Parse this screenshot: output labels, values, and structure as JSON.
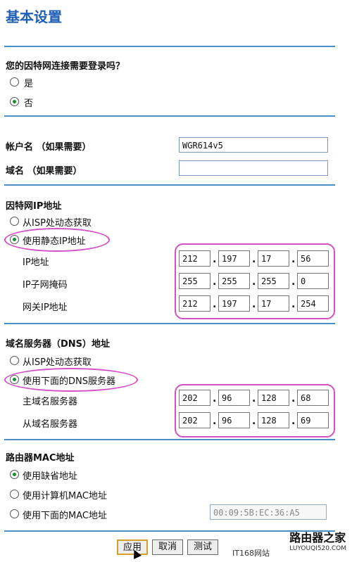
{
  "page": {
    "title": "基本设置",
    "q_login": "您的因特网连接需要登录吗？",
    "opt_yes": "是",
    "opt_no": "否",
    "account": {
      "label": "帐户名 （如果需要）",
      "value": "WGR614v5"
    },
    "domain": {
      "label": "域名 （如果需要）",
      "value": ""
    },
    "internet_ip": {
      "title": "因特网IP地址",
      "opt_dynamic": "从ISP处动态获取",
      "opt_static": "使用静态IP地址",
      "ip_label": "IP地址",
      "mask_label": "IP子网掩码",
      "gw_label": "网关IP地址",
      "ip": [
        "212",
        "197",
        "17",
        "56"
      ],
      "mask": [
        "255",
        "255",
        "255",
        "0"
      ],
      "gw": [
        "212",
        "197",
        "17",
        "254"
      ]
    },
    "dns": {
      "title": "域名服务器（DNS）地址",
      "opt_dynamic": "从ISP处动态获取",
      "opt_below": "使用下面的DNS服务器",
      "primary_label": "主域名服务器",
      "secondary_label": "从域名服务器",
      "primary": [
        "202",
        "96",
        "128",
        "68"
      ],
      "secondary": [
        "202",
        "96",
        "128",
        "69"
      ]
    },
    "mac": {
      "title": "路由器MAC地址",
      "opt_default": "使用缺省地址",
      "opt_computer": "使用计算机MAC地址",
      "opt_below": "使用下面的MAC地址",
      "value": "00:09:5B:EC:36:A5"
    },
    "buttons": {
      "apply": "应用",
      "cancel": "取消",
      "test": "测试"
    },
    "watermark": {
      "left": "IT168网站",
      "brand": "路由器之家",
      "url": "LUYOUQI520.COM"
    }
  }
}
